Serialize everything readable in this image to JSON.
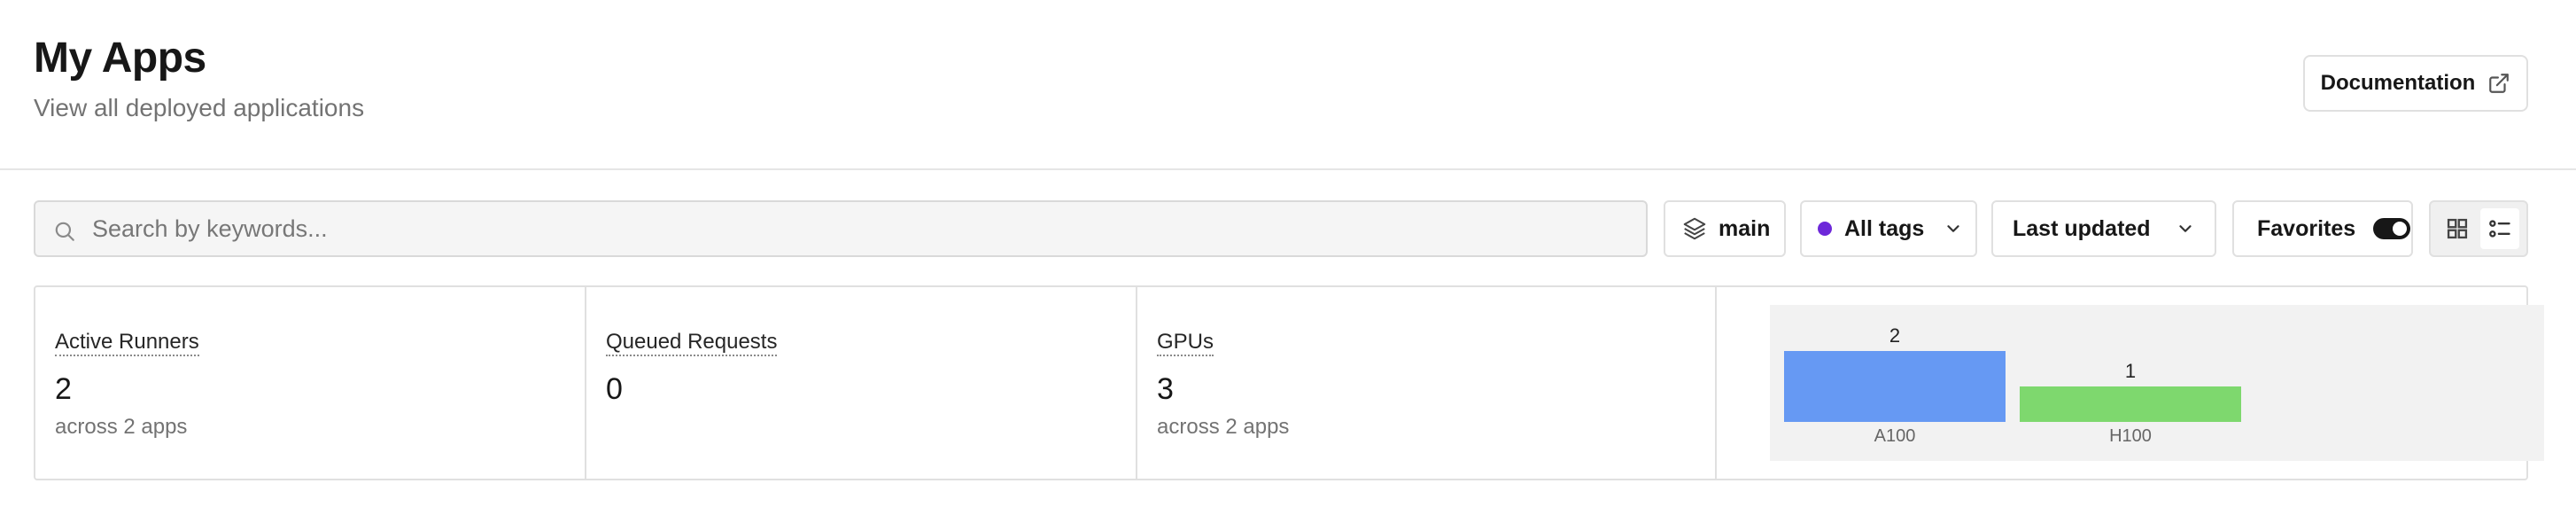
{
  "header": {
    "title": "My Apps",
    "subtitle": "View all deployed applications",
    "documentation_label": "Documentation"
  },
  "toolbar": {
    "search_placeholder": "Search by keywords...",
    "branch_label": "main",
    "tags_label": "All tags",
    "sort_label": "Last updated",
    "favorites_label": "Favorites",
    "favorites_enabled": true,
    "view_mode": "list"
  },
  "stats": {
    "active_runners": {
      "label": "Active Runners",
      "value": "2",
      "sub": "across 2 apps"
    },
    "queued_requests": {
      "label": "Queued Requests",
      "value": "0"
    },
    "gpus": {
      "label": "GPUs",
      "value": "3",
      "sub": "across 2 apps"
    }
  },
  "colors": {
    "tag_dot": "#6d28d9",
    "bar_a100": "#6699f3",
    "bar_h100": "#7ed86e"
  },
  "chart_data": {
    "type": "bar",
    "categories": [
      "A100",
      "H100"
    ],
    "values": [
      2,
      1
    ],
    "colors": [
      "#6699f3",
      "#7ed86e"
    ],
    "ylim": [
      0,
      2
    ],
    "grid": false
  }
}
